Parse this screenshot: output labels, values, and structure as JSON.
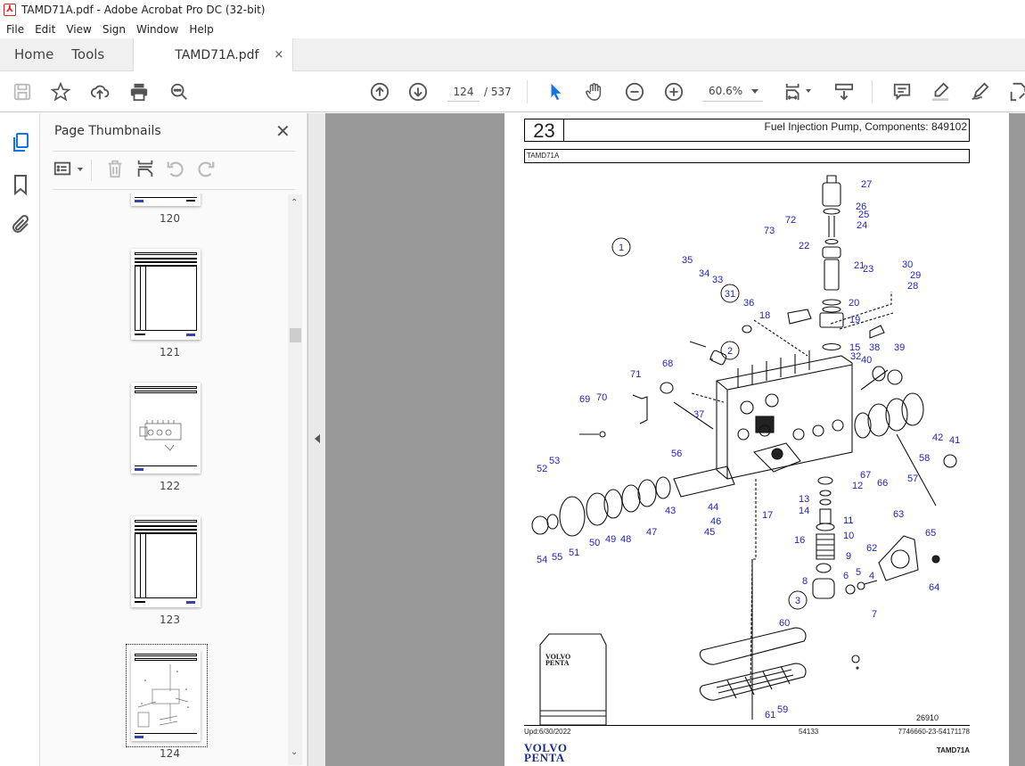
{
  "window": {
    "title": "TAMD71A.pdf - Adobe Acrobat Pro DC (32-bit)",
    "app_icon": "acrobat-icon"
  },
  "menu": [
    "File",
    "Edit",
    "View",
    "Sign",
    "Window",
    "Help"
  ],
  "tabs": {
    "home": "Home",
    "tools": "Tools",
    "document": "TAMD71A.pdf",
    "close": "×"
  },
  "toolbar": {
    "icons": [
      "save-icon",
      "bookmark-star-icon",
      "upload-cloud-icon",
      "print-icon",
      "search-zoom-icon",
      "page-up-icon",
      "page-down-icon",
      "select-pointer-icon",
      "hand-icon",
      "zoom-out-icon",
      "zoom-in-icon",
      "fit-page-icon",
      "scroll-mode-icon",
      "comment-icon",
      "highlight-icon",
      "sign-pen-icon",
      "edit-pdf-icon"
    ],
    "current_page": "124",
    "total_pages": "/ 537",
    "zoom": "60.6%",
    "accent": "#1473e6"
  },
  "sidebar": {
    "title": "Page Thumbnails",
    "close": "✕",
    "rail_icons": [
      "page-thumbnails-icon",
      "bookmarks-icon",
      "attachments-icon"
    ],
    "tool_icons": [
      "thumbnail-options-icon",
      "delete-page-icon",
      "insert-page-icon",
      "rotate-ccw-icon",
      "rotate-cw-icon"
    ],
    "thumbnails": [
      {
        "label": "120"
      },
      {
        "label": "121"
      },
      {
        "label": "122"
      },
      {
        "label": "123"
      },
      {
        "label": "124",
        "selected": true
      }
    ]
  },
  "page": {
    "section": "23",
    "title": "Fuel Injection Pump, Components: 849102",
    "model": "TAMD71A",
    "figure_no": "26910",
    "updated": "Upd:6/30/2022",
    "code": "54133",
    "part_ref": "7746660-23-54171178",
    "brand_line1": "VOLVO",
    "brand_line2": "PENTA",
    "footer_model": "TAMD71A",
    "callouts_circled": [
      "1",
      "2",
      "3",
      "31"
    ],
    "callouts": [
      "4",
      "5",
      "6",
      "7",
      "8",
      "9",
      "10",
      "11",
      "12",
      "13",
      "14",
      "15",
      "16",
      "17",
      "18",
      "19",
      "20",
      "21",
      "22",
      "23",
      "24",
      "25",
      "26",
      "27",
      "28",
      "29",
      "30",
      "32",
      "33",
      "34",
      "35",
      "36",
      "37",
      "38",
      "39",
      "40",
      "41",
      "42",
      "43",
      "44",
      "45",
      "46",
      "47",
      "48",
      "49",
      "50",
      "51",
      "52",
      "53",
      "54",
      "55",
      "56",
      "57",
      "58",
      "59",
      "60",
      "61",
      "62",
      "63",
      "64",
      "65",
      "66",
      "67",
      "68",
      "69",
      "70",
      "71",
      "72",
      "73"
    ],
    "manual_cover_text1": "VOLVO",
    "manual_cover_text2": "PENTA"
  }
}
